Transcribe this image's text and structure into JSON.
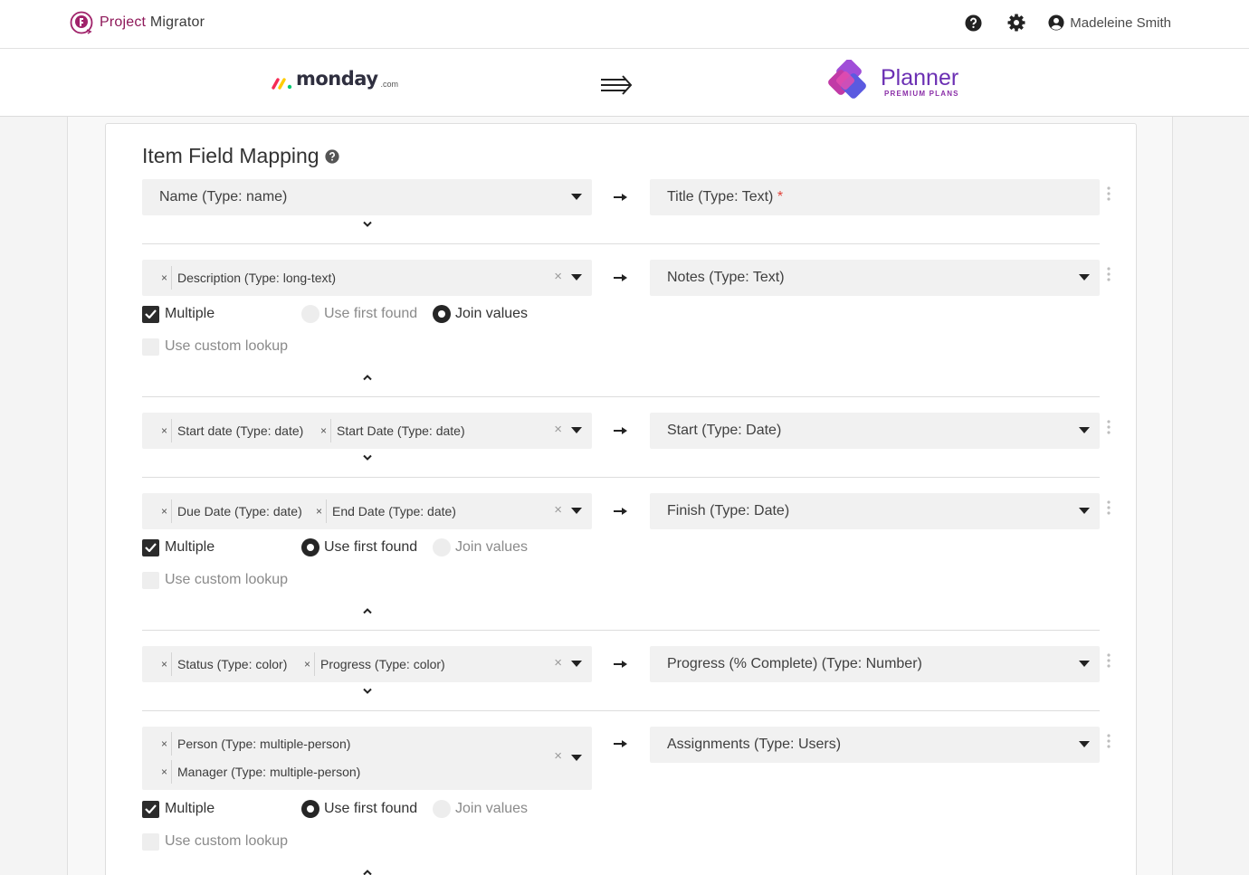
{
  "app": {
    "name_part1": "Project",
    "name_part2": "Migrator",
    "user_name": "Madeleine Smith",
    "icons": [
      "help-icon",
      "settings-icon",
      "user-avatar-icon"
    ]
  },
  "banner": {
    "source_word": "monday",
    "source_tld": ".com",
    "target_name": "Planner",
    "target_sub": "PREMIUM PLANS"
  },
  "page": {
    "title": "Item Field Mapping"
  },
  "options": {
    "multiple": "Multiple",
    "use_first_found": "Use first found",
    "join_values": "Join values",
    "use_custom_lookup": "Use custom lookup",
    "required_mark": "*"
  },
  "mappings": [
    {
      "source_single": "Name (Type: name)",
      "target": "Title (Type: Text) ",
      "target_required": true,
      "expanded": false
    },
    {
      "sources": [
        "Description (Type: long-text)"
      ],
      "target": "Notes (Type: Text)",
      "expanded": true,
      "multiple_checked": true,
      "mode": "join_values",
      "custom_lookup": false
    },
    {
      "sources": [
        "Start date (Type: date)",
        "Start Date (Type: date)"
      ],
      "target": "Start (Type: Date)",
      "expanded": false
    },
    {
      "sources": [
        "Due Date (Type: date)",
        "End Date (Type: date)"
      ],
      "target": "Finish (Type: Date)",
      "expanded": true,
      "multiple_checked": true,
      "mode": "use_first_found",
      "custom_lookup": false
    },
    {
      "sources": [
        "Status (Type: color)",
        "Progress (Type: color)"
      ],
      "target": "Progress (% Complete) (Type: Number)",
      "expanded": false
    },
    {
      "sources": [
        "Person (Type: multiple-person)",
        "Manager (Type: multiple-person)"
      ],
      "target": "Assignments (Type: Users)",
      "expanded": true,
      "multiple_checked": true,
      "mode": "use_first_found",
      "custom_lookup": false
    }
  ],
  "colors": {
    "brand": "#8e1859",
    "planner": "#6b2fb3",
    "required": "#e0433a"
  }
}
